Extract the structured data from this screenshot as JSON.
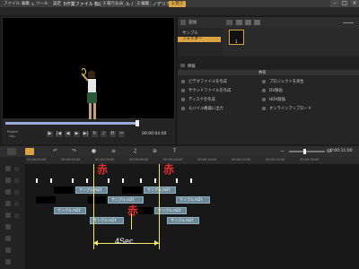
{
  "window": {
    "title": "Corel VideoStudio Pro - 3 4 5作業ファイル 転画面モジュール / チャプ・ノデリア.VSP"
  },
  "menu": [
    "ファイル",
    "編集",
    "ツール",
    "設定"
  ],
  "steps": [
    "1 取り込み",
    "2 編集",
    "3 完了"
  ],
  "library": {
    "add_label": "追加",
    "folders": [
      "サンプル",
      "フォルダー"
    ],
    "thumb_label": "1",
    "info_label": "情報",
    "section_label": "共有",
    "tasks": [
      "ビデオファイルを作成",
      "サウンドファイルを作成",
      "ディスクを作成",
      "モバイル機器に出力",
      "プロジェクトを再生",
      "DV録画",
      "HDV録画",
      "オンラインアップロード"
    ]
  },
  "player": {
    "mode_project": "Project",
    "mode_clip": "Clip",
    "timecode": "00:00:04:00"
  },
  "timeline": {
    "timecode": "0:00:11:00",
    "ruler": [
      "00:00:00:00",
      "00:00:02:00",
      "00:00:04:00",
      "00:00:06:00",
      "00:00:08:00",
      "00:00:10:00",
      "00:00:12:00",
      "00:00:14:00",
      "00:00:16:00"
    ],
    "clip_label": "サンプル.m2t",
    "clip_label_v": "サンプル.m2t"
  },
  "annotations": {
    "marker": "赤",
    "duration": "4Sec."
  },
  "colors": {
    "accent": "#d9a441",
    "clip": "#6b8796",
    "annotation_line": "#f2e86a",
    "annotation_text": "#e63030"
  }
}
